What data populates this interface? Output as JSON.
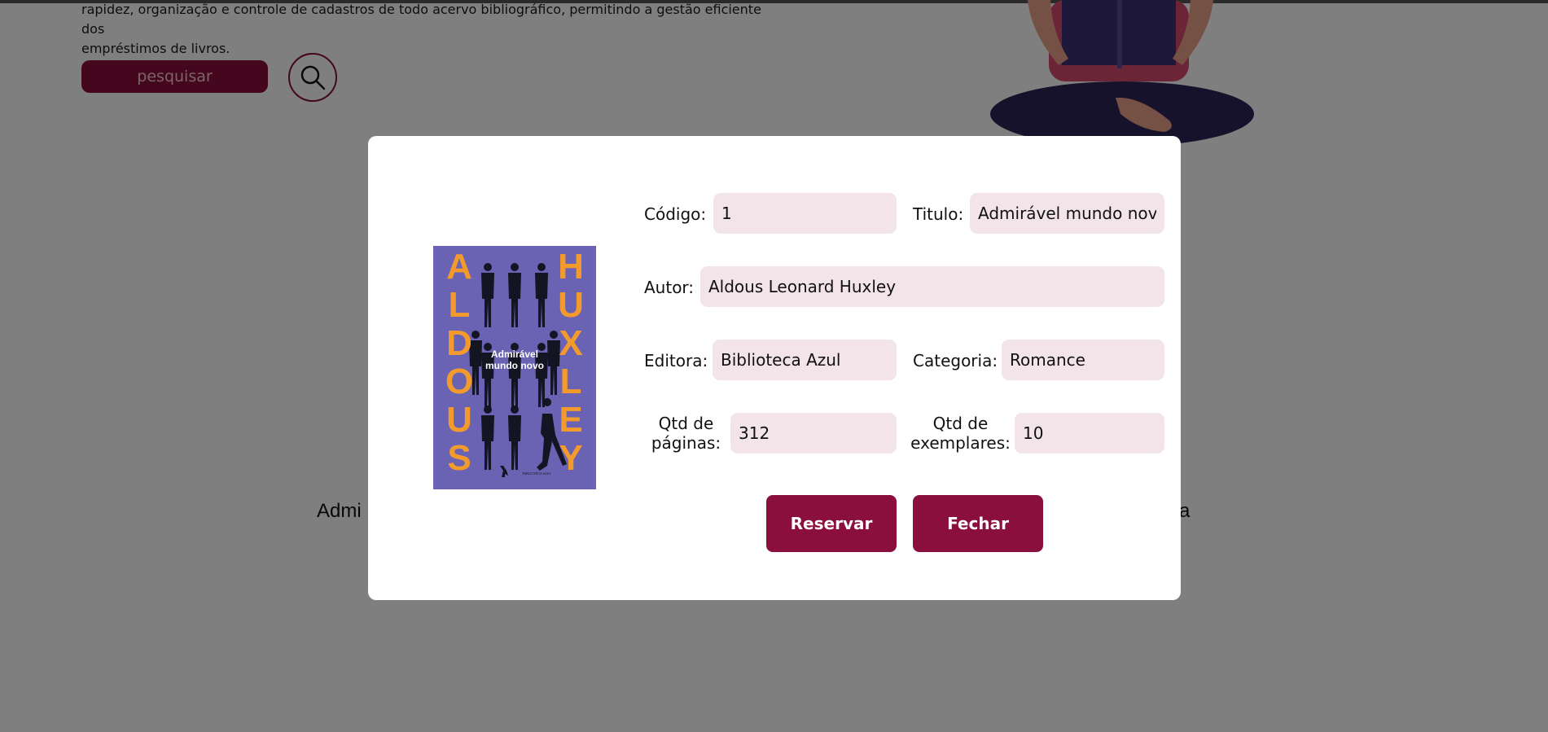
{
  "background": {
    "intro_line1": "rapidez, organização e controle de cadastros de todo acervo bibliográfico, permitindo a gestão eficiente dos",
    "intro_line2": "empréstimos de livros.",
    "search_button": "pesquisar",
    "search_icon": "search-icon",
    "book_label_left": "Admi",
    "book_label_right": "ra"
  },
  "modal": {
    "cover": {
      "author_left": [
        "A",
        "L",
        "D",
        "O",
        "U",
        "S"
      ],
      "author_right": [
        "H",
        "U",
        "X",
        "L",
        "E",
        "Y"
      ],
      "title_line1": "Admirável",
      "title_line2": "mundo novo",
      "publisher": "BIBLIOTECA AZUL",
      "bg_color": "#6a63b4",
      "accent_color": "#f39a2c"
    },
    "fields": {
      "codigo": {
        "label": "Código:",
        "value": "1"
      },
      "titulo": {
        "label": "Titulo:",
        "value": "Admirável mundo novo"
      },
      "autor": {
        "label": "Autor:",
        "value": "Aldous Leonard Huxley"
      },
      "editora": {
        "label": "Editora:",
        "value": "Biblioteca Azul"
      },
      "categoria": {
        "label": "Categoria:",
        "value": "Romance"
      },
      "paginas": {
        "label_line1": "Qtd de",
        "label_line2": "páginas:",
        "value": "312"
      },
      "exemplares": {
        "label_line1": "Qtd de",
        "label_line2": "exemplares:",
        "value": "10"
      }
    },
    "buttons": {
      "reservar": "Reservar",
      "fechar": "Fechar"
    }
  },
  "colors": {
    "accent": "#8b0f3c",
    "field_bg": "#f2e4e9",
    "overlay": "rgba(0,0,0,0.5)"
  }
}
